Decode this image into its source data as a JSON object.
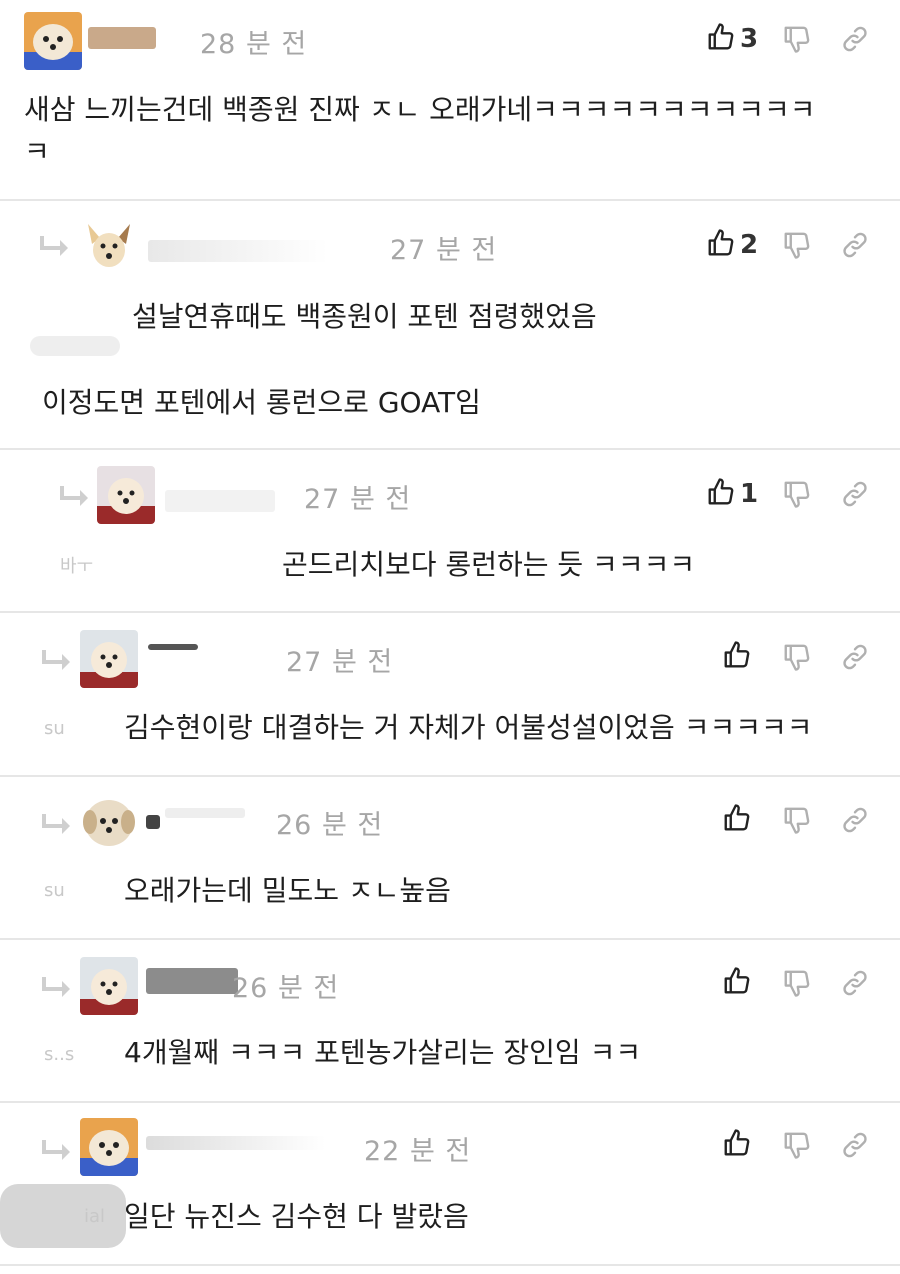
{
  "comments": [
    {
      "time": "28 분 전",
      "likes": "3",
      "lines": [
        "새삼 느끼는건데 백종원 진짜 ㅈㄴ 오래가네ㅋㅋㅋㅋㅋㅋㅋㅋㅋㅋㅋ",
        "ㅋ"
      ]
    },
    {
      "time": "27 분 전",
      "likes": "2",
      "lines": [
        "설날연휴때도 백종원이 포텐 점령했었음",
        "이정도면 포텐에서 롱런으로 GOAT임"
      ]
    },
    {
      "time": "27 분 전",
      "likes": "1",
      "lines": [
        "곤드리치보다 롱런하는 듯 ㅋㅋㅋㅋ"
      ]
    },
    {
      "time": "27 분 전",
      "likes": "",
      "lines": [
        "김수현이랑 대결하는 거 자체가 어불성설이었음 ㅋㅋㅋㅋㅋ"
      ]
    },
    {
      "time": "26 분 전",
      "likes": "",
      "lines": [
        "오래가는데 밀도노 ㅈㄴ높음"
      ]
    },
    {
      "time": "26 분 전",
      "likes": "",
      "lines": [
        "4개월째 ㅋㅋㅋ 포텐농가살리는 장인임 ㅋㅋ"
      ]
    },
    {
      "time": "22 분 전",
      "likes": "",
      "lines": [
        "일단 뉴진스 김수현 다 발랐음"
      ]
    }
  ],
  "smudges": [
    "바ㅜ",
    "su",
    "su",
    "s..s",
    "ial"
  ],
  "colors": {
    "accent": "#333333",
    "muted": "#a6a6a6",
    "divider": "#e6e6e6"
  }
}
